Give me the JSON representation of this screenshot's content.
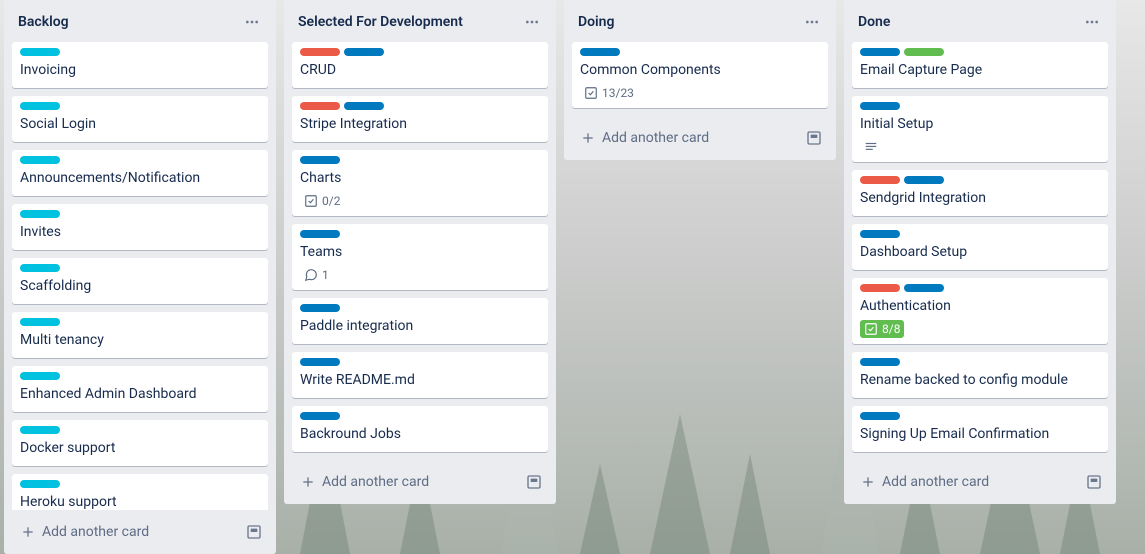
{
  "ui": {
    "add_card_label": "Add another card"
  },
  "lists": [
    {
      "title": "Backlog",
      "cards": [
        {
          "labels": [
            "sky"
          ],
          "title": "Invoicing"
        },
        {
          "labels": [
            "sky"
          ],
          "title": "Social Login"
        },
        {
          "labels": [
            "sky"
          ],
          "title": "Announcements/Notification"
        },
        {
          "labels": [
            "sky"
          ],
          "title": "Invites"
        },
        {
          "labels": [
            "sky"
          ],
          "title": "Scaffolding"
        },
        {
          "labels": [
            "sky"
          ],
          "title": "Multi tenancy"
        },
        {
          "labels": [
            "sky"
          ],
          "title": "Enhanced Admin Dashboard"
        },
        {
          "labels": [
            "sky"
          ],
          "title": "Docker support"
        },
        {
          "labels": [
            "sky"
          ],
          "title": "Heroku support"
        }
      ]
    },
    {
      "title": "Selected For Development",
      "cards": [
        {
          "labels": [
            "red",
            "blue"
          ],
          "title": "CRUD"
        },
        {
          "labels": [
            "red",
            "blue"
          ],
          "title": "Stripe Integration"
        },
        {
          "labels": [
            "blue"
          ],
          "title": "Charts",
          "checklist": "0/2"
        },
        {
          "labels": [
            "blue"
          ],
          "title": "Teams",
          "comments": "1"
        },
        {
          "labels": [
            "blue"
          ],
          "title": "Paddle integration"
        },
        {
          "labels": [
            "blue"
          ],
          "title": "Write README.md"
        },
        {
          "labels": [
            "blue"
          ],
          "title": "Backround Jobs"
        }
      ]
    },
    {
      "title": "Doing",
      "cards": [
        {
          "labels": [
            "blue"
          ],
          "title": "Common Components",
          "checklist": "13/23"
        }
      ]
    },
    {
      "title": "Done",
      "cards": [
        {
          "labels": [
            "blue",
            "green"
          ],
          "title": "Email Capture Page"
        },
        {
          "labels": [
            "blue"
          ],
          "title": "Initial Setup",
          "description": true
        },
        {
          "labels": [
            "red",
            "blue"
          ],
          "title": "Sendgrid Integration"
        },
        {
          "labels": [
            "blue"
          ],
          "title": "Dashboard Setup"
        },
        {
          "labels": [
            "red",
            "blue"
          ],
          "title": "Authentication",
          "checklist": "8/8",
          "checklist_complete": true
        },
        {
          "labels": [
            "blue"
          ],
          "title": "Rename backed to config module"
        },
        {
          "labels": [
            "blue"
          ],
          "title": "Signing Up Email Confirmation"
        }
      ]
    }
  ]
}
